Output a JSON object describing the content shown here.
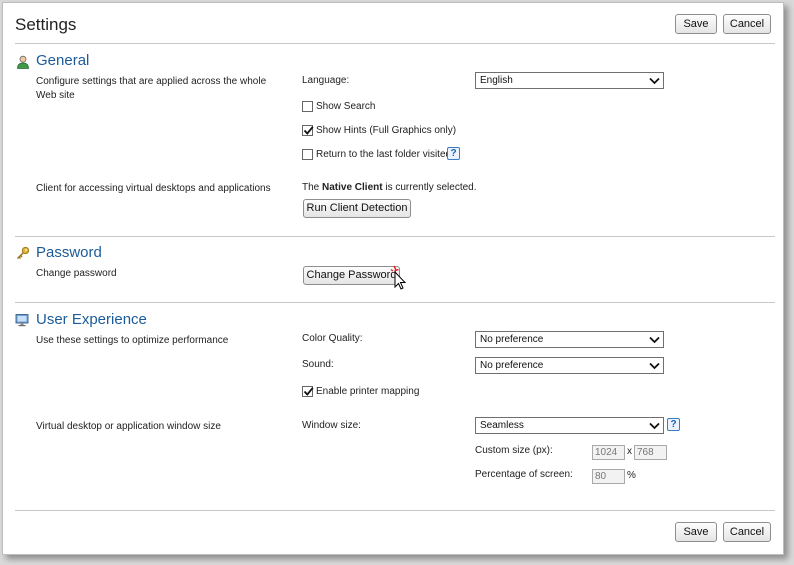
{
  "page": {
    "title": "Settings"
  },
  "top_buttons": {
    "save": "Save",
    "cancel": "Cancel"
  },
  "bottom_buttons": {
    "save": "Save",
    "cancel": "Cancel"
  },
  "general": {
    "title": "General",
    "icon": "user-icon",
    "description": "Configure settings that are applied across the whole Web site",
    "language_label": "Language:",
    "language_value": "English",
    "show_search_label": "Show Search",
    "show_search_checked": false,
    "show_hints_label": "Show Hints (Full Graphics only)",
    "show_hints_checked": true,
    "return_folder_label": "Return to the last folder visited",
    "return_folder_checked": false,
    "client_description": "Client for accessing virtual desktops and applications",
    "client_status_prefix": "The ",
    "client_status_bold": "Native Client",
    "client_status_suffix": " is currently selected.",
    "run_detection_label": "Run Client Detection"
  },
  "password": {
    "title": "Password",
    "icon": "key-icon",
    "description": "Change password",
    "change_button": "Change Password"
  },
  "user_experience": {
    "title": "User Experience",
    "icon": "monitor-icon",
    "description": "Use these settings to optimize performance",
    "color_quality_label": "Color Quality:",
    "color_quality_value": "No preference",
    "sound_label": "Sound:",
    "sound_value": "No preference",
    "printer_mapping_label": "Enable printer mapping",
    "printer_mapping_checked": true,
    "window_description": "Virtual desktop or application window size",
    "window_size_label": "Window size:",
    "window_size_value": "Seamless",
    "custom_size_label": "Custom size (px):",
    "custom_width": "1024",
    "custom_sep": "x",
    "custom_height": "768",
    "percentage_label": "Percentage of screen:",
    "percentage_value": "80",
    "percent_sign": "%"
  },
  "help_glyph": "?",
  "colors": {
    "section_title": "#1c5b99",
    "divider": "#c8c8c8",
    "help": "#3a7dc4"
  }
}
